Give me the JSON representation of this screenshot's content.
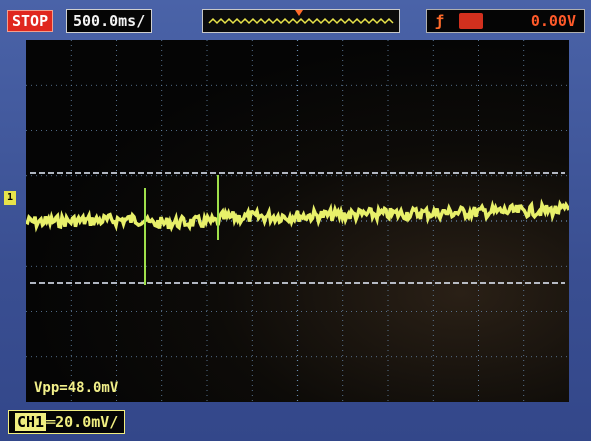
{
  "status": "STOP",
  "timebase": "500.0ms/",
  "trigger": {
    "level": "0.00V"
  },
  "channel": {
    "marker": "1",
    "label": "CH1",
    "scale": "20.0mV/"
  },
  "measurement": {
    "vpp": "Vpp=48.0mV"
  },
  "colors": {
    "trace": "#e8f06a",
    "grid": "#6a8cb0",
    "status_bg": "#e0281e",
    "trigger": "#ff6a2a"
  }
}
